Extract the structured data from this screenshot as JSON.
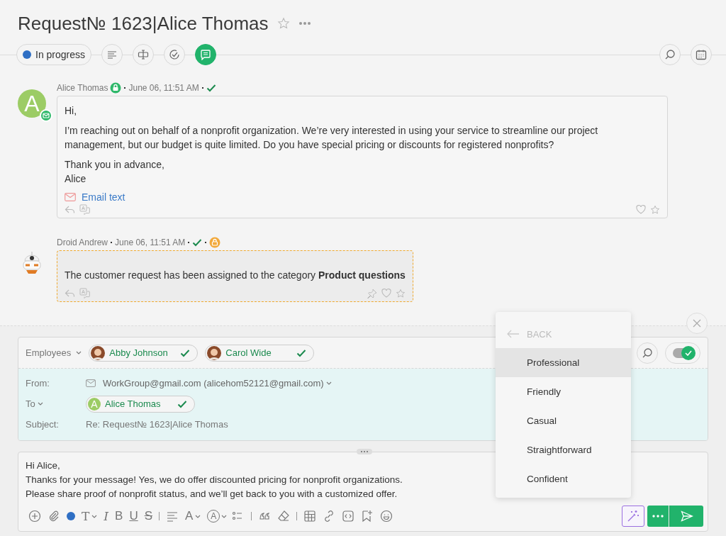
{
  "title": "Request№ 1623|Alice Thomas",
  "status": {
    "label": "In progress",
    "color": "#2f6fc4"
  },
  "tools": [
    {
      "kind": "description",
      "selected": false
    },
    {
      "kind": "fields",
      "selected": false
    },
    {
      "kind": "tasks",
      "selected": false
    },
    {
      "kind": "chat",
      "selected": true
    }
  ],
  "messages": [
    {
      "kind": "customer",
      "author": "Alice Thomas",
      "avatar_letter": "A",
      "time": "June 06, 11:51 AM",
      "paragraphs": [
        "Hi,",
        "I’m reaching out on behalf of a nonprofit organization. We’re very interested in using your service to streamline our project management, but our budget is quite limited. Do you have special pricing or discounts for registered nonprofits?",
        "Thank you in advance,\nAlice"
      ],
      "link": "Email text"
    },
    {
      "kind": "bot",
      "author": "Droid Andrew",
      "time": "June 06, 11:51 AM",
      "paragraphs": [
        "The customer request has been assigned to the category **Product questions**"
      ]
    }
  ],
  "compose": {
    "employees_label": "Employees",
    "employees": [
      {
        "name": "Abby Johnson"
      },
      {
        "name": "Carol Wide"
      }
    ],
    "toggle_on": true,
    "from_label": "From:",
    "from": "WorkGroup@gmail.com (alicehom52121@gmail.com)",
    "to_label": "To",
    "to": {
      "letter": "A",
      "name": "Alice Thomas"
    },
    "subject_label": "Subject:",
    "subject": "Re: Request№ 1623|Alice Thomas",
    "body": "Hi Alice,\nThanks for your message! Yes, we do offer discounted pricing for nonprofit organizations.\nPlease share proof of nonprofit status, and we’ll get back to you with a customized offer."
  },
  "editor_tools": [
    {
      "kind": "add"
    },
    {
      "kind": "attach"
    },
    {
      "kind": "color",
      "color": "#2f6fc4"
    },
    {
      "kind": "font",
      "text": "T"
    },
    {
      "kind": "italic",
      "text": "I"
    },
    {
      "kind": "bold",
      "text": "B"
    },
    {
      "kind": "underline",
      "text": "U"
    },
    {
      "kind": "strike",
      "text": "S"
    },
    {
      "kind": "sep"
    },
    {
      "kind": "align"
    },
    {
      "kind": "size",
      "text": "A"
    },
    {
      "kind": "textcolor",
      "text": "A"
    },
    {
      "kind": "list"
    },
    {
      "kind": "sep"
    },
    {
      "kind": "quote"
    },
    {
      "kind": "eraser"
    },
    {
      "kind": "sep"
    },
    {
      "kind": "table"
    },
    {
      "kind": "link"
    },
    {
      "kind": "code"
    },
    {
      "kind": "bookmark"
    },
    {
      "kind": "emoji"
    }
  ],
  "menu": {
    "back": "BACK",
    "items": [
      {
        "label": "Professional",
        "selected": true
      },
      {
        "label": "Friendly",
        "selected": false
      },
      {
        "label": "Casual",
        "selected": false
      },
      {
        "label": "Straightforward",
        "selected": false
      },
      {
        "label": "Confident",
        "selected": false
      }
    ]
  }
}
